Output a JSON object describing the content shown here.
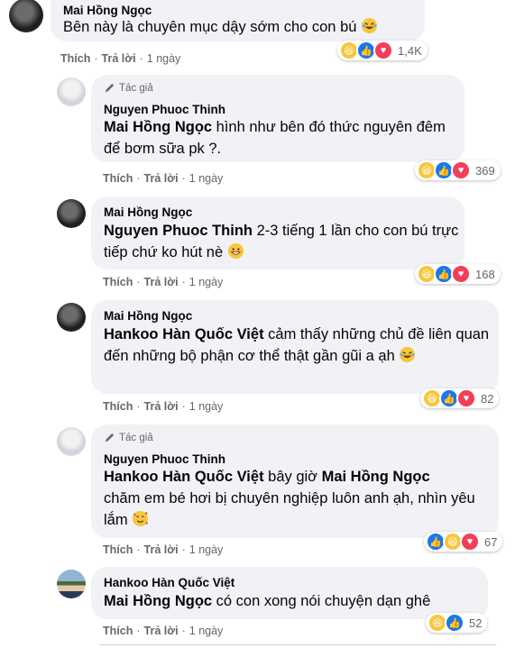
{
  "comments": [
    {
      "name": "Mai Hồng Ngọc",
      "text": "Bên này là chuyên mục dậy sớm cho con bú",
      "emoji": "rofl-emoji",
      "actions": {
        "like": "Thích",
        "reply": "Trả lời",
        "time": "1 ngày"
      },
      "reactions": {
        "icons": [
          "haha",
          "like",
          "love"
        ],
        "count": "1,4K"
      }
    },
    {
      "author_badge": "Tác giả",
      "name": "Nguyen Phuoc Thinh",
      "mention": "Mai Hồng Ngọc",
      "text": " hình như bên đó thức nguyên đêm để bơm sữa pk ?.",
      "actions": {
        "like": "Thích",
        "reply": "Trả lời",
        "time": "1 ngày"
      },
      "reactions": {
        "icons": [
          "haha",
          "like",
          "love"
        ],
        "count": "369"
      }
    },
    {
      "name": "Mai Hồng Ngọc",
      "mention": "Nguyen Phuoc Thinh",
      "text": " 2-3 tiếng 1 lần cho con bú trực tiếp chứ ko hút nè",
      "emoji": "grin-emoji",
      "actions": {
        "like": "Thích",
        "reply": "Trả lời",
        "time": "1 ngày"
      },
      "reactions": {
        "icons": [
          "haha",
          "like",
          "love"
        ],
        "count": "168"
      }
    },
    {
      "name": "Mai Hồng Ngọc",
      "mention": "Hankoo Hàn Quốc Việt",
      "text": " cảm thấy những chủ đề liên quan đến những bộ phận cơ thể thật gần gũi a ạh",
      "emoji": "rofl-emoji",
      "actions": {
        "like": "Thích",
        "reply": "Trả lời",
        "time": "1 ngày"
      },
      "reactions": {
        "icons": [
          "haha",
          "like",
          "love"
        ],
        "count": "82"
      }
    },
    {
      "author_badge": "Tác giả",
      "name": "Nguyen Phuoc Thinh",
      "mention": "Hankoo Hàn Quốc Việt",
      "text_mid": " bây giờ ",
      "mention2": "Mai Hồng Ngọc",
      "text": "chăm em bé hơi bị chuyên nghiệp luôn anh ạh, nhìn yêu lắm",
      "emoji": "hearts-emoji",
      "actions": {
        "like": "Thích",
        "reply": "Trả lời",
        "time": "1 ngày"
      },
      "reactions": {
        "icons": [
          "like",
          "haha",
          "love"
        ],
        "count": "67"
      }
    },
    {
      "name": "Hankoo Hàn Quốc Việt",
      "mention": "Mai Hồng Ngọc",
      "text": " có con xong nói chuyện dạn ghê",
      "actions": {
        "like": "Thích",
        "reply": "Trả lời",
        "time": "1 ngày"
      },
      "reactions": {
        "icons": [
          "haha",
          "like"
        ],
        "count": "52"
      }
    }
  ]
}
